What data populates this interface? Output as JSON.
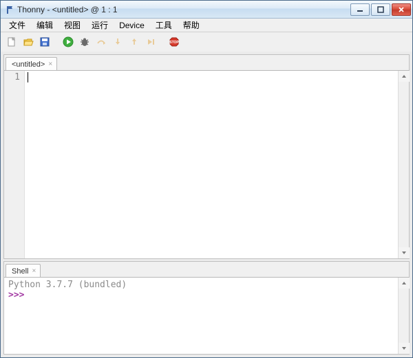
{
  "titlebar": {
    "text": "Thonny  -  <untitled>  @  1 : 1"
  },
  "menubar": {
    "items": [
      "文件",
      "编辑",
      "视图",
      "运行",
      "Device",
      "工具",
      "帮助"
    ]
  },
  "toolbar": {
    "new": {
      "name": "new-file-icon"
    },
    "open": {
      "name": "open-file-icon"
    },
    "save": {
      "name": "save-icon"
    },
    "run": {
      "name": "run-icon"
    },
    "debug": {
      "name": "debug-icon"
    },
    "over": {
      "name": "step-over-icon"
    },
    "into": {
      "name": "step-into-icon"
    },
    "out": {
      "name": "step-out-icon"
    },
    "resume": {
      "name": "resume-icon"
    },
    "stop": {
      "name": "stop-icon"
    }
  },
  "editor": {
    "tab_label": "<untitled>",
    "line_numbers": [
      "1"
    ],
    "content": ""
  },
  "shell": {
    "tab_label": "Shell",
    "banner": "Python 3.7.7 (bundled)",
    "prompt": ">>>"
  }
}
